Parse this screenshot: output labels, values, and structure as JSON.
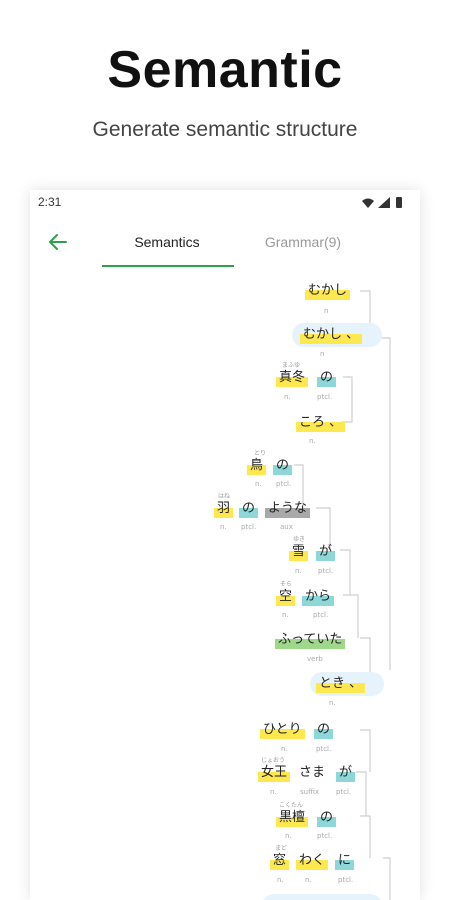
{
  "hero": {
    "title": "Semantic",
    "subtitle": "Generate semantic structure"
  },
  "status": {
    "time": "2:31"
  },
  "tabs": [
    {
      "label": "Semantics",
      "active": true
    },
    {
      "label": "Grammar(9)",
      "active": false
    }
  ],
  "colors": {
    "accent": "#2ca04a",
    "noun": "#fde84f",
    "particle": "#8dd7d8",
    "aux": "#a9a9a9",
    "verb": "#9fd88b",
    "clause": "#e6f2fc"
  },
  "tree": {
    "mukashi1": {
      "text": "むかし",
      "pos": "n"
    },
    "mukashi2": {
      "text": "むかし 、",
      "pos": "n"
    },
    "mafuyu": {
      "text": "真冬",
      "ruby": "まふゆ",
      "pos": "n."
    },
    "no1": {
      "text": "の",
      "pos": "ptcl."
    },
    "koro": {
      "text": "ころ 、",
      "pos": "n."
    },
    "tori": {
      "text": "鳥",
      "ruby": "とり",
      "pos": "n."
    },
    "no2": {
      "text": "の",
      "pos": "ptcl."
    },
    "hane": {
      "text": "羽",
      "ruby": "はね",
      "pos": "n."
    },
    "no3": {
      "text": "の",
      "pos": "ptcl."
    },
    "youna": {
      "text": "ような",
      "pos": "aux"
    },
    "yuki": {
      "text": "雪",
      "ruby": "ゆき",
      "pos": "n."
    },
    "ga1": {
      "text": "が",
      "pos": "ptcl."
    },
    "sora": {
      "text": "空",
      "ruby": "そら",
      "pos": "n."
    },
    "kara": {
      "text": "から",
      "pos": "ptcl."
    },
    "futteita": {
      "text": "ふっていた",
      "pos": "verb"
    },
    "toki": {
      "text": "とき 、",
      "pos": "n."
    },
    "hitori": {
      "text": "ひとり",
      "pos": "n."
    },
    "no4": {
      "text": "の",
      "pos": "ptcl."
    },
    "joou": {
      "text": "女王",
      "ruby": "じょおう",
      "pos": "n."
    },
    "sama": {
      "text": "さま",
      "pos": "suffix"
    },
    "ga2": {
      "text": "が",
      "pos": "ptcl."
    },
    "kokutan": {
      "text": "黒檀",
      "ruby": "こくたん",
      "pos": "n."
    },
    "no5": {
      "text": "の",
      "pos": "ptcl."
    },
    "mado": {
      "text": "窓",
      "ruby": "まど",
      "pos": "n."
    },
    "waku": {
      "text": "わく",
      "pos": "n."
    },
    "ni": {
      "text": "に",
      "pos": "ptcl."
    }
  }
}
